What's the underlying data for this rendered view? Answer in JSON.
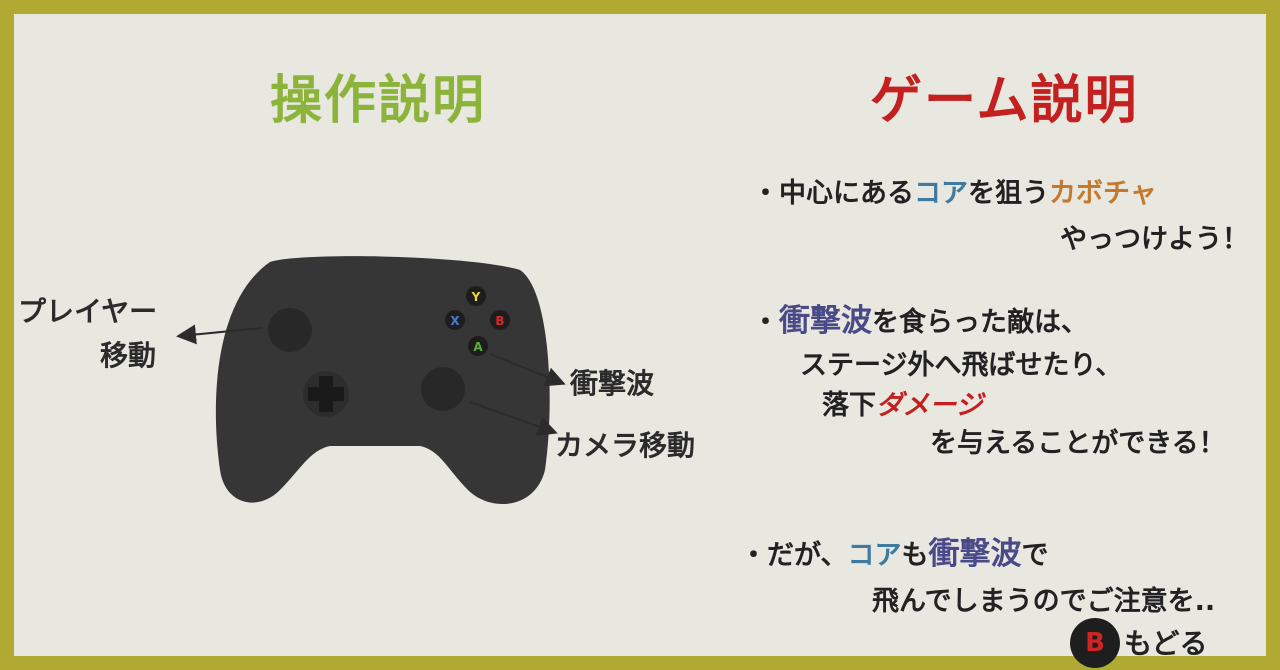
{
  "titles": {
    "controls": "操作説明",
    "game": "ゲーム説明"
  },
  "controller": {
    "buttons": {
      "y": "Y",
      "x": "X",
      "b": "B",
      "a": "A"
    },
    "labels": {
      "move_line1": "プレイヤー",
      "move_line2": "移動",
      "shockwave": "衝撃波",
      "camera": "カメラ移動"
    }
  },
  "game": {
    "line1_a": "・中心にある",
    "line1_core": "コア",
    "line1_b": "を狙う",
    "line1_pumpkin": "カボチャ",
    "line2": "やっつけよう！",
    "line3_a": "・",
    "line3_wave": "衝撃波",
    "line3_b": "を食らった敵は、",
    "line4": "ステージ外へ飛ばせたり、",
    "line5_a": "落下",
    "line5_dmg": "ダメージ",
    "line6": "を与えることができる！",
    "line7_a": "・だが、",
    "line7_core": "コア",
    "line7_b": "も",
    "line7_wave": "衝撃波",
    "line7_c": "で",
    "line8": "飛んでしまうのでご注意を.."
  },
  "back": {
    "button": "B",
    "label": "もどる"
  },
  "colors": {
    "frame": "#b0aa32",
    "background": "#e8e7e0",
    "controls_title": "#8db43a",
    "game_title": "#c42020",
    "core": "#3f7aa0",
    "pumpkin": "#c47a2e",
    "shockwave": "#4a4a88",
    "damage": "#c42020"
  }
}
